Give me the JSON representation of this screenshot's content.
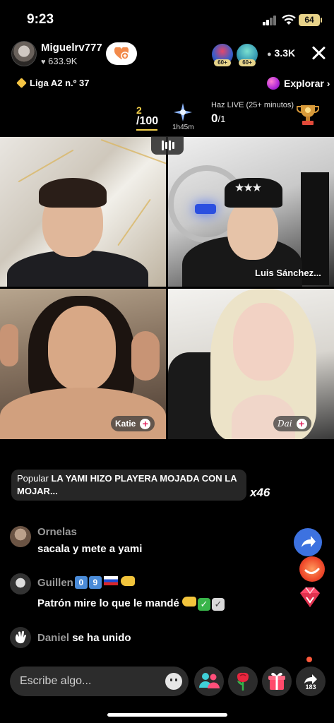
{
  "status_bar": {
    "time": "9:23",
    "battery": "64"
  },
  "host": {
    "username": "Miguelrv777",
    "likes": "633.9K",
    "viewers": "3.3K"
  },
  "badges": [
    {
      "label": "60+"
    },
    {
      "label": "60+"
    }
  ],
  "league": {
    "label": "Liga A2 n.º 37"
  },
  "explore": {
    "label": "Explorar"
  },
  "goal": {
    "progress": "2",
    "total": "/100",
    "timer": "1h45m"
  },
  "live_goal": {
    "label": "Haz LIVE (25+ minutos)",
    "value": "0",
    "total": "/1"
  },
  "guests": [
    {
      "name": ""
    },
    {
      "name": "Luis Sánchez..."
    },
    {
      "name": "Katie"
    },
    {
      "name": "Dai"
    }
  ],
  "pinned": {
    "prefix": "Popular",
    "text": "LA YAMI HIZO PLAYERA MOJADA CON LA MOJAR...",
    "multiplier": "x46"
  },
  "comments": [
    {
      "user": "Ornelas",
      "text": "sacala y mete a yami"
    },
    {
      "user": "Guillen",
      "chips": [
        "0",
        "9"
      ],
      "text": "Patrón mire lo que le mandé"
    },
    {
      "user": "Daniel",
      "text": "se ha unido"
    }
  ],
  "bottom_bar": {
    "input_placeholder": "Escribe algo...",
    "share_count": "183"
  },
  "colors": {
    "accent_gold": "#f6d24a",
    "share_blue": "#3d72e0",
    "gift_pink": "#ff4a6b"
  }
}
